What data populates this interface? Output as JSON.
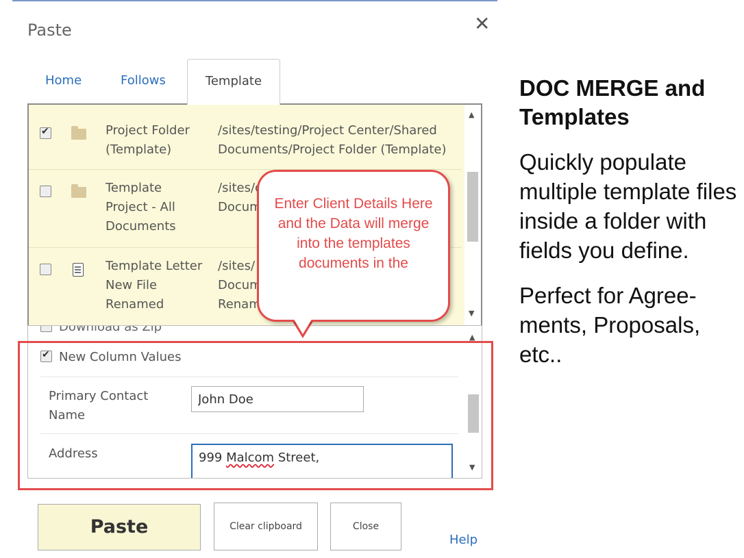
{
  "dialog": {
    "title": "Paste",
    "close_glyph": "✕",
    "tabs": [
      "Home",
      "Follows",
      "Template"
    ],
    "active_tab": "Template"
  },
  "list": {
    "rows": [
      {
        "checked": true,
        "icon": "folder-icon",
        "name": "Project Folder (Template)",
        "path": "/sites/testing/Project Center/Shared Documents/Project Folder (Template)",
        "path_line1": "/sites/testing/Project Center/Shared",
        "path_line2": "Documents/Project Folder (Template)"
      },
      {
        "checked": false,
        "icon": "folder-icon",
        "name": "Template Project - All Documents",
        "path_line1": "/sites/d",
        "path_line2": "Docum"
      },
      {
        "checked": false,
        "icon": "document-icon",
        "name": "Template Letter New File Renamed",
        "path_line1": "/sites/",
        "path_line2": "Docum",
        "path_line3": "Renam"
      }
    ]
  },
  "form": {
    "download_zip_label": "Download as Zip",
    "new_column_values_label": "New Column Values",
    "new_column_values_checked": true,
    "fields": [
      {
        "label": "Primary Contact Name",
        "value": "John Doe"
      },
      {
        "label": "Address",
        "value_prefix": "999 ",
        "value_misspelled": "Malcom",
        "value_suffix": " Street,"
      }
    ]
  },
  "callout": {
    "text": "Enter Client Details Here and the Data will merge into the templates documents in the",
    "color": "#e34b4b"
  },
  "buttons": {
    "paste": "Paste",
    "clear_clipboard": "Clear clipboard",
    "close": "Close",
    "help": "Help"
  },
  "side": {
    "heading": "DOC MERGE and Templates",
    "paragraph1": "Quickly populate multiple template files inside a folder with fields you define.",
    "paragraph2": "Perfect for Agree-ments, Proposals, etc.."
  },
  "colors": {
    "link_blue": "#2a6ebb",
    "highlight_red": "#e34b4b",
    "list_background": "#fbf9d9"
  }
}
